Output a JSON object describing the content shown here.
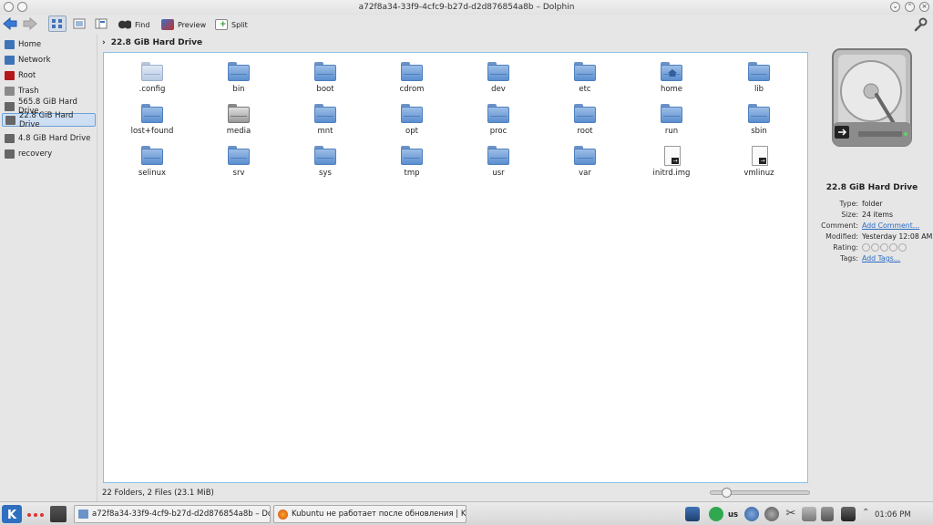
{
  "window": {
    "title": "a72f8a34-33f9-4cfc9-b27d-d2d876854a8b – Dolphin"
  },
  "toolbar": {
    "find_label": "Find",
    "preview_label": "Preview",
    "split_label": "Split"
  },
  "places": [
    {
      "label": "Home",
      "icon": "home-icon",
      "color": "#3f73b8"
    },
    {
      "label": "Network",
      "icon": "network-icon",
      "color": "#3f73b8"
    },
    {
      "label": "Root",
      "icon": "root-folder-icon",
      "color": "#b3181c"
    },
    {
      "label": "Trash",
      "icon": "trash-icon",
      "color": "#8a8a8a"
    },
    {
      "label": "565.8 GiB Hard Drive",
      "icon": "hard-drive-icon",
      "color": "#666"
    },
    {
      "label": "22.8 GiB Hard Drive",
      "icon": "hard-drive-icon",
      "color": "#666"
    },
    {
      "label": "4.8 GiB Hard Drive",
      "icon": "hard-drive-icon",
      "color": "#666"
    },
    {
      "label": "recovery",
      "icon": "hard-drive-icon",
      "color": "#666"
    }
  ],
  "breadcrumb": {
    "path": "22.8 GiB Hard Drive"
  },
  "items": [
    {
      "name": ".config",
      "icon": "hidden-folder-icon"
    },
    {
      "name": "bin",
      "icon": "folder-icon"
    },
    {
      "name": "boot",
      "icon": "folder-icon"
    },
    {
      "name": "cdrom",
      "icon": "folder-icon"
    },
    {
      "name": "dev",
      "icon": "folder-icon"
    },
    {
      "name": "etc",
      "icon": "folder-icon"
    },
    {
      "name": "home",
      "icon": "home-folder-icon"
    },
    {
      "name": "lib",
      "icon": "folder-icon"
    },
    {
      "name": "lost+found",
      "icon": "folder-icon"
    },
    {
      "name": "media",
      "icon": "drive-folder-icon"
    },
    {
      "name": "mnt",
      "icon": "folder-icon"
    },
    {
      "name": "opt",
      "icon": "folder-icon"
    },
    {
      "name": "proc",
      "icon": "folder-icon"
    },
    {
      "name": "root",
      "icon": "folder-icon"
    },
    {
      "name": "run",
      "icon": "folder-icon"
    },
    {
      "name": "sbin",
      "icon": "folder-icon"
    },
    {
      "name": "selinux",
      "icon": "folder-icon"
    },
    {
      "name": "srv",
      "icon": "folder-icon"
    },
    {
      "name": "sys",
      "icon": "folder-icon"
    },
    {
      "name": "tmp",
      "icon": "folder-icon"
    },
    {
      "name": "usr",
      "icon": "folder-icon"
    },
    {
      "name": "var",
      "icon": "folder-icon"
    },
    {
      "name": "initrd.img",
      "icon": "symlink-file-icon"
    },
    {
      "name": "vmlinuz",
      "icon": "symlink-file-icon"
    }
  ],
  "status": {
    "text": "22 Folders, 2 Files (23.1 MiB)"
  },
  "info": {
    "name": "22.8 GiB Hard Drive",
    "type_key": "Type:",
    "type_val": "folder",
    "size_key": "Size:",
    "size_val": "24 items",
    "comment_key": "Comment:",
    "comment_val": "Add Comment...",
    "modified_key": "Modified:",
    "modified_val": "Yesterday 12:08 AM",
    "rating_key": "Rating:",
    "tags_key": "Tags:",
    "tags_val": "Add Tags..."
  },
  "taskbar": {
    "task1": "a72f8a34-33f9-4cf9-b27d-d2d876854a8b – Dol",
    "task2": "Kubuntu не работает после обновления | Kub",
    "keyboard_layout": "us",
    "clock": "01:06 PM"
  },
  "colors": {
    "accent": "#6e9fd6",
    "folder": "#6b93c8",
    "link": "#2b6cc4"
  }
}
